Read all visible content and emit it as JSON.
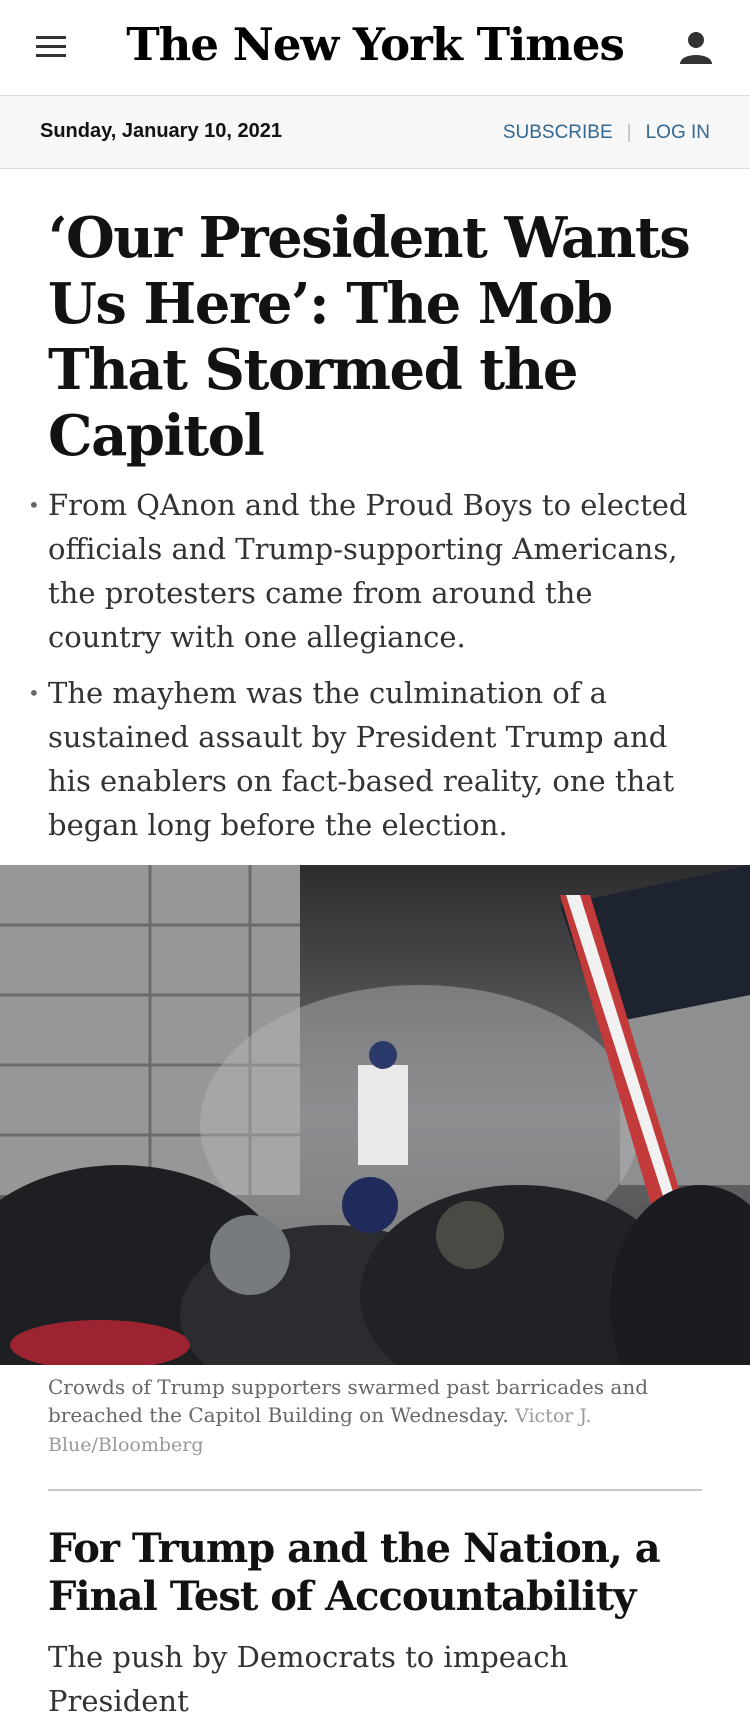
{
  "header": {
    "masthead": "The New York Times",
    "menu_icon": "hamburger-menu-icon",
    "user_icon": "user-account-icon"
  },
  "datebar": {
    "date": "Sunday, January 10, 2021",
    "subscribe_label": "SUBSCRIBE",
    "login_label": "LOG IN",
    "separator": "|"
  },
  "lead_story": {
    "headline": "‘Our President Wants Us Here’: The Mob That Stormed the Capitol",
    "summary": [
      "From QAnon and the Proud Boys to elected officials and Trump-supporting Americans, the protesters came from around the country with one allegiance.",
      "The mayhem was the culmination of a sustained assault by President Trump and his enablers on fact-based reality, one that began long before the election."
    ],
    "caption": "Crowds of Trump supporters swarmed past barricades and breached the Capitol Building on Wednesday.",
    "credit": "Victor J. Blue/Bloomberg"
  },
  "second_story": {
    "headline": "For Trump and the Nation, a Final Test of Accountability",
    "summary_start": "The push by Democrats to impeach President"
  },
  "colors": {
    "link": "#326891",
    "text": "#121212",
    "muted": "#666666"
  }
}
